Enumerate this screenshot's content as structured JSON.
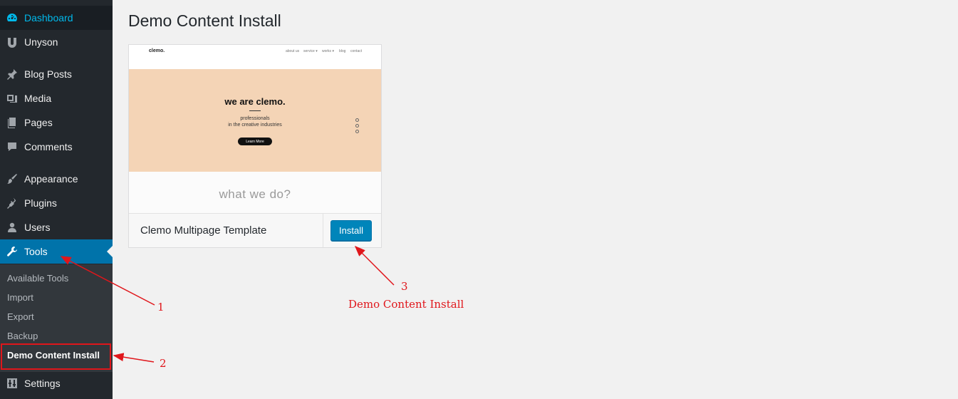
{
  "sidebar": {
    "items": [
      {
        "label": "Dashboard",
        "icon": "dashboard-icon"
      },
      {
        "label": "Unyson",
        "icon": "unyson-icon"
      },
      {
        "label": "Blog Posts",
        "icon": "pin-icon"
      },
      {
        "label": "Media",
        "icon": "media-icon"
      },
      {
        "label": "Pages",
        "icon": "pages-icon"
      },
      {
        "label": "Comments",
        "icon": "comments-icon"
      },
      {
        "label": "Appearance",
        "icon": "brush-icon"
      },
      {
        "label": "Plugins",
        "icon": "plugin-icon"
      },
      {
        "label": "Users",
        "icon": "users-icon"
      },
      {
        "label": "Tools",
        "icon": "wrench-icon",
        "current": true
      },
      {
        "label": "Settings",
        "icon": "settings-icon"
      }
    ],
    "submenu": [
      {
        "label": "Available Tools"
      },
      {
        "label": "Import"
      },
      {
        "label": "Export"
      },
      {
        "label": "Backup"
      },
      {
        "label": "Demo Content Install",
        "active": true
      }
    ]
  },
  "main": {
    "title": "Demo Content Install",
    "card": {
      "preview": {
        "logo": "clemo.",
        "nav": [
          "about us",
          "service ▾",
          "works ▾",
          "blog",
          "contact"
        ],
        "hero_title": "we are clemo.",
        "hero_sub1": "professionals",
        "hero_sub2": "in the creative industries",
        "hero_button": "Learn More",
        "section_title": "what we do?"
      },
      "name": "Clemo Multipage Template",
      "install_label": "Install"
    }
  },
  "annotations": {
    "n1": "1",
    "n2": "2",
    "n3": "3",
    "note": "Demo Content Install"
  },
  "colors": {
    "sidebar_bg": "#23282d",
    "accent": "#0073aa",
    "annotation": "#e0161b"
  }
}
